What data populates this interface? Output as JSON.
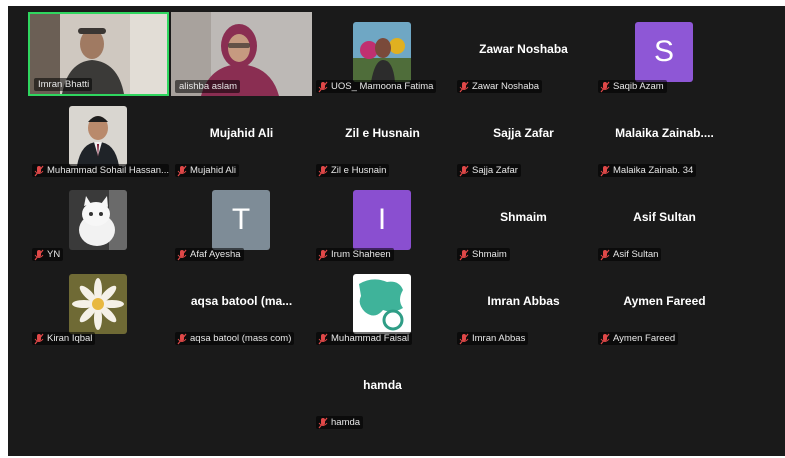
{
  "colors": {
    "background": "#1a1a1a",
    "active_border": "#2fd65f",
    "avatar_s": "#8e57d6",
    "avatar_t": "#7e8c97",
    "avatar_i": "#8a4fd0"
  },
  "participants": [
    {
      "label": "Imran Bhatti",
      "muted": false,
      "active": true,
      "tile": "video"
    },
    {
      "label": "alishba aslam",
      "muted": false,
      "tile": "video"
    },
    {
      "label": "UOS_ Mamoona Fatima",
      "muted": true,
      "tile": "photo"
    },
    {
      "label": "Zawar Noshaba",
      "display_name": "Zawar Noshaba",
      "muted": true
    },
    {
      "label": "Saqib Azam",
      "muted": true,
      "avatar_letter": "S"
    },
    {
      "label": "Muhammad Sohail Hassan...",
      "muted": true,
      "tile": "photo"
    },
    {
      "label": "Mujahid Ali",
      "display_name": "Mujahid Ali",
      "muted": true
    },
    {
      "label": "Zil e Husnain",
      "display_name": "Zil e Husnain",
      "muted": true
    },
    {
      "label": "Sajja Zafar",
      "display_name": "Sajja Zafar",
      "muted": true
    },
    {
      "label": "Malaika Zainab. 34",
      "display_name": "Malaika  Zainab....",
      "muted": true
    },
    {
      "label": "YN",
      "muted": true,
      "tile": "photo"
    },
    {
      "label": "Afaf Ayesha",
      "muted": true,
      "avatar_letter": "T"
    },
    {
      "label": "Irum Shaheen",
      "muted": true,
      "avatar_letter": "I"
    },
    {
      "label": "Shmaim",
      "display_name": "Shmaim",
      "muted": true
    },
    {
      "label": "Asif Sultan",
      "display_name": "Asif Sultan",
      "muted": true
    },
    {
      "label": "Kiran Iqbal",
      "muted": true,
      "tile": "photo"
    },
    {
      "label": "aqsa batool (mass com)",
      "display_name": "aqsa batool  (ma...",
      "muted": true
    },
    {
      "label": "Muhammad Faisal",
      "muted": true,
      "tile": "photo"
    },
    {
      "label": "Imran Abbas",
      "display_name": "Imran Abbas",
      "muted": true
    },
    {
      "label": "Aymen Fareed",
      "display_name": "Aymen Fareed",
      "muted": true
    },
    {
      "label": "hamda",
      "display_name": "hamda",
      "muted": true
    }
  ]
}
